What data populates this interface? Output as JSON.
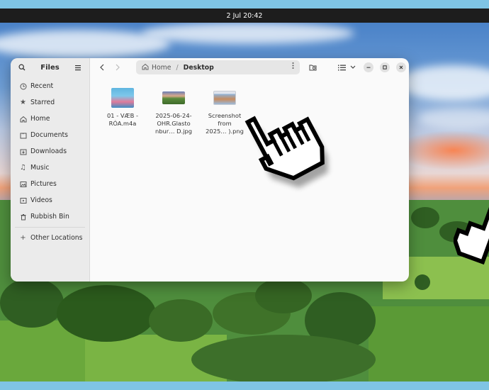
{
  "topbar": {
    "datetime": "2 Jul  20:42"
  },
  "window": {
    "app_title": "Files",
    "sidebar": {
      "items": [
        {
          "label": "Recent",
          "icon": "clock-icon"
        },
        {
          "label": "Starred",
          "icon": "star-icon"
        },
        {
          "label": "Home",
          "icon": "home-icon"
        },
        {
          "label": "Documents",
          "icon": "document-icon"
        },
        {
          "label": "Downloads",
          "icon": "download-icon"
        },
        {
          "label": "Music",
          "icon": "music-icon"
        },
        {
          "label": "Pictures",
          "icon": "picture-icon"
        },
        {
          "label": "Videos",
          "icon": "video-icon"
        },
        {
          "label": "Rubbish Bin",
          "icon": "trash-icon"
        }
      ],
      "other_locations": "Other Locations"
    },
    "path": {
      "home": "Home",
      "separator": "/",
      "current": "Desktop"
    },
    "files": [
      {
        "name": "01 - VÆB -\nRÓA.m4a"
      },
      {
        "name": "2025-06-24-\nOHR.Glasto\nnbur… D.jpg"
      },
      {
        "name": "Screenshot\nfrom\n2025… ).png"
      }
    ]
  },
  "colors": {
    "topbar": "#1d1d1d",
    "frame": "#7fc4e4",
    "sidebar": "#ebebeb",
    "content": "#fafafa"
  }
}
